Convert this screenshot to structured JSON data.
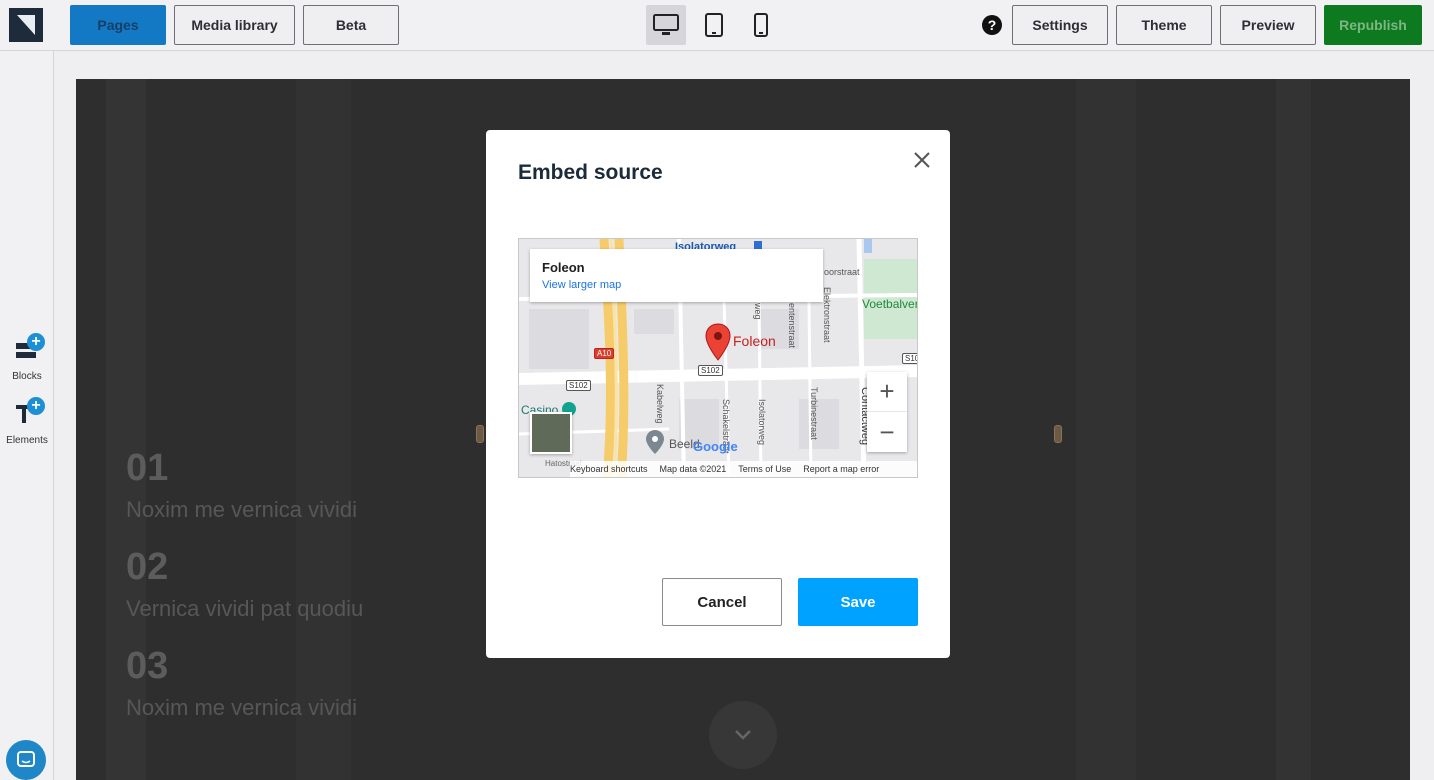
{
  "toolbar": {
    "pages_label": "Pages",
    "media_label": "Media library",
    "beta_label": "Beta",
    "help_glyph": "?",
    "settings_label": "Settings",
    "theme_label": "Theme",
    "preview_label": "Preview",
    "republish_label": "Republish",
    "devices": [
      "desktop-icon",
      "tablet-icon",
      "mobile-icon"
    ],
    "active_device": "desktop",
    "accent": "#1379c5",
    "republish_color": "#0e7a1f"
  },
  "sidebar": {
    "blocks_label": "Blocks",
    "elements_label": "Elements"
  },
  "canvas": {
    "items": [
      {
        "number": "01",
        "text": "Noxim me vernica vividi"
      },
      {
        "number": "02",
        "text": "Vernica vividi pat quodiu"
      },
      {
        "number": "03",
        "text": "Noxim me vernica vividi"
      }
    ]
  },
  "modal": {
    "title": "Embed source",
    "cancel_label": "Cancel",
    "save_label": "Save",
    "save_color": "#00a2ff",
    "map": {
      "place_name": "Foleon",
      "view_larger": "View larger map",
      "marker_label": "Foleon",
      "labels": {
        "isolatorweg_top": "Isolatorweg",
        "voetbalveren": "Voetbalveren",
        "casino": "Casino",
        "beeld": "Beeld",
        "hato": "Hatostraat",
        "kabelweg": "Kabelweg",
        "schakelstraat": "Schakelstraat",
        "isolatorweg": "Isolatorweg",
        "turbinestraat": "Turbinestraat",
        "contactweg": "Contactweg",
        "elektronstraat": "Elektronstraat",
        "centenstraat": "entenstraat",
        "dynamo": "weg",
        "oorstraat": "oorstraat"
      },
      "road_badges": {
        "a10": "A10",
        "s102_a": "S102",
        "s102_b": "S102",
        "s10": "S10"
      },
      "google_logo": "Google",
      "keyboard": "Keyboard shortcuts",
      "map_data": "Map data ©2021",
      "terms": "Terms of Use",
      "report": "Report a map error",
      "zoom_in": "+",
      "zoom_out": "−"
    }
  }
}
